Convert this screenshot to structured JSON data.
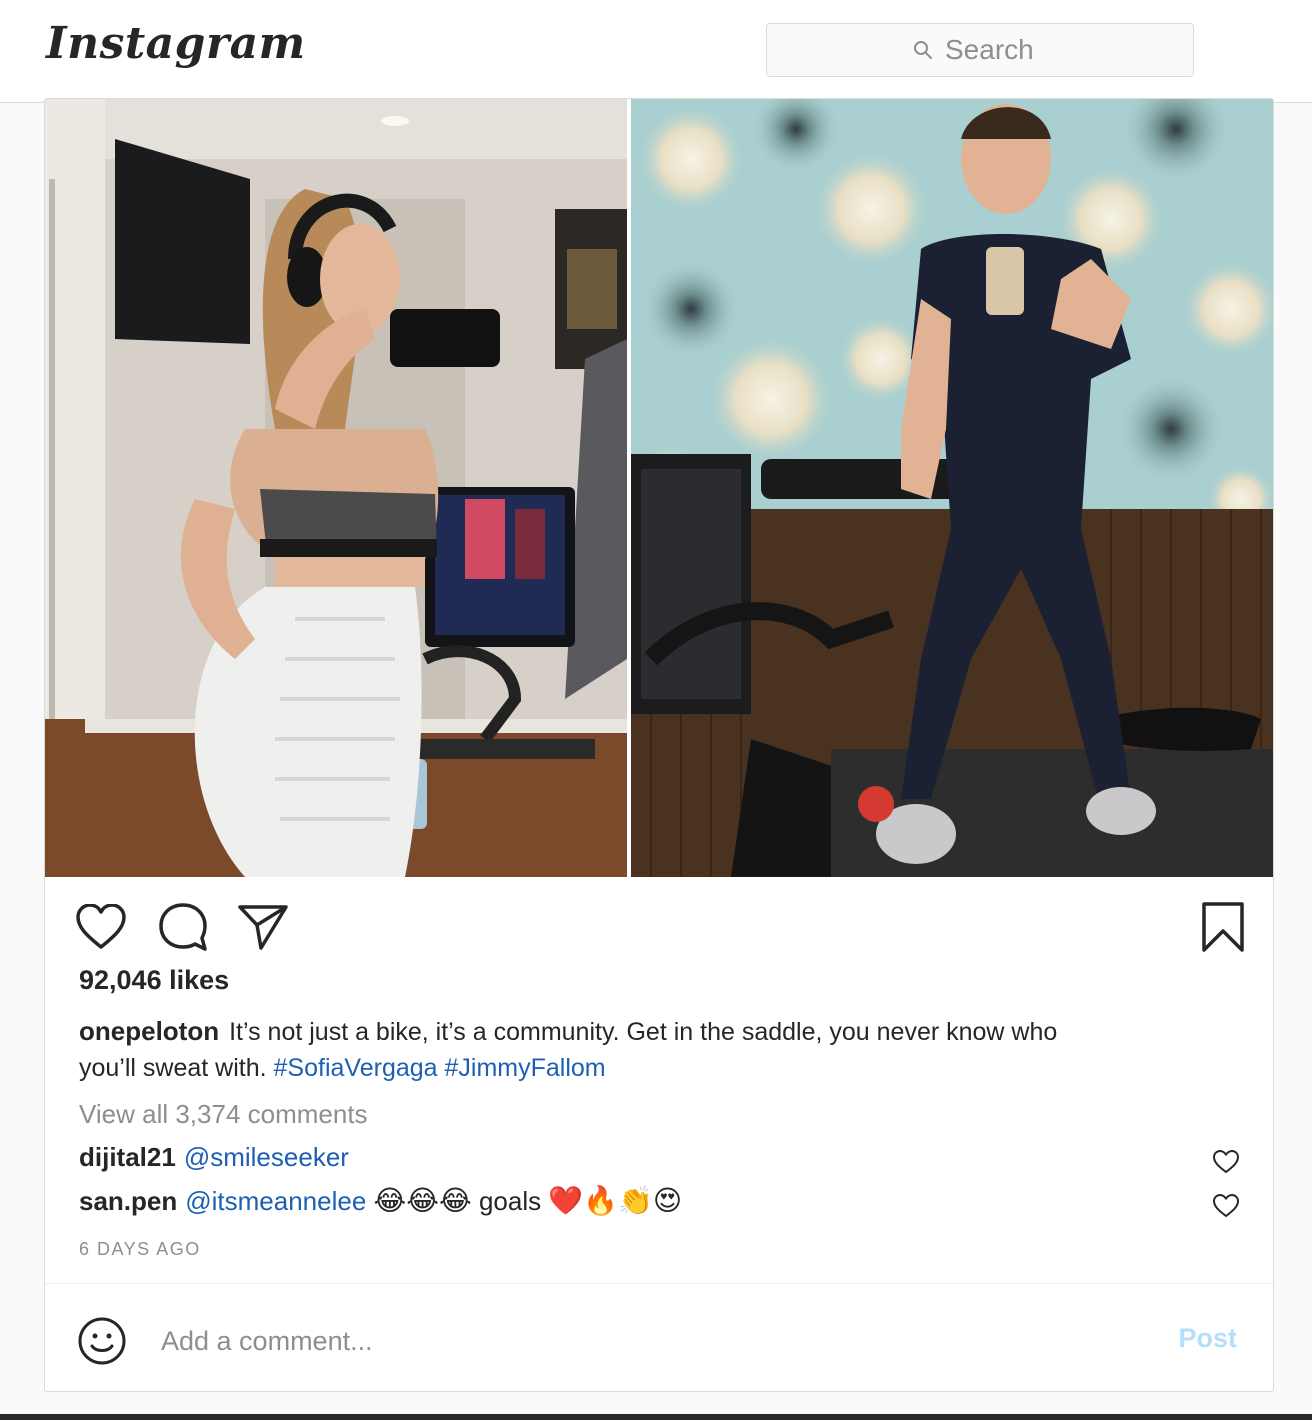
{
  "header": {
    "logo_text": "Instagram",
    "search_placeholder": "Search",
    "search_icon": "search-icon"
  },
  "post": {
    "images": [
      {
        "name": "photo-left",
        "description_icon": "photo"
      },
      {
        "name": "photo-right",
        "description_icon": "photo"
      }
    ],
    "actions": {
      "like_icon": "heart-icon",
      "comment_icon": "comment-bubble-icon",
      "share_icon": "paper-plane-icon",
      "save_icon": "bookmark-icon"
    },
    "likes_text": "92,046 likes",
    "caption": {
      "username": "onepeloton",
      "text": "It’s not just a bike, it’s a community. Get in the saddle, you never know who you’ll sweat with.",
      "hashtags": [
        "#SofiaVergaga",
        "#JimmyFallom"
      ]
    },
    "view_all_comments": "View all 3,374 comments",
    "comments": [
      {
        "username": "dijital21",
        "mention": "@smileseeker",
        "text": ""
      },
      {
        "username": "san.pen",
        "mention": "@itsmeannelee",
        "emojis_before": "😂😂😂",
        "text": "goals",
        "emojis_after": "❤️🔥👏😍"
      }
    ],
    "timestamp": "6 DAYS AGO",
    "add_comment_placeholder": "Add a comment...",
    "post_button": "Post"
  },
  "colors": {
    "link_blue": "#1e5fb4",
    "muted_gray": "#8e8e8e",
    "post_disabled": "#b2dffc",
    "border": "#dbdbdb"
  }
}
